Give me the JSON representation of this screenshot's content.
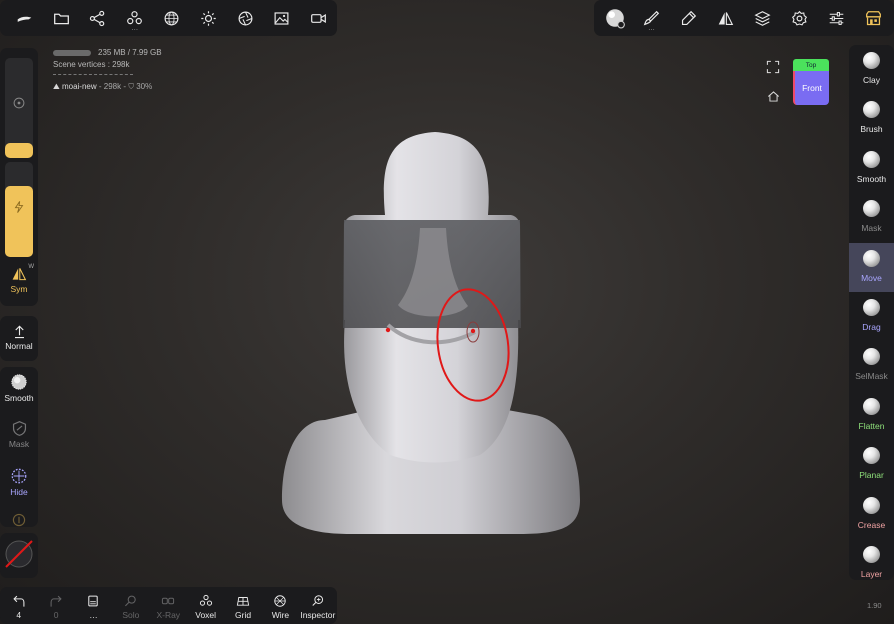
{
  "top_toolbar_left": {
    "icons": [
      "pointer-arrow-icon",
      "folder-icon",
      "scene-graph-icon",
      "primitives-icon",
      "wireframe-sphere-icon",
      "lighting-sun-icon",
      "aperture-icon",
      "image-icon",
      "video-camera-icon"
    ]
  },
  "top_toolbar_right": {
    "icons": [
      "material-sphere-icon",
      "paint-brush-icon",
      "stroke-pen-icon",
      "symmetry-icon",
      "layers-icon",
      "settings-gear-icon",
      "sliders-icon",
      "store-icon"
    ]
  },
  "info": {
    "memory": "235 MB / 7.99 GB",
    "scene_vertices": "Scene vertices : 298k",
    "mesh_name": "moai-new",
    "mesh_details": " - 298k - ",
    "mesh_percent": "30%"
  },
  "left_panel": {
    "radius_value": 0.15,
    "intensity_value": 0.75,
    "sym_label": "Sym",
    "sym_badge": "W",
    "normal_label": "Normal",
    "smooth_label": "Smooth",
    "mask_label": "Mask",
    "hide_label": "Hide"
  },
  "right_tools": {
    "items": [
      {
        "label": "Clay",
        "color": "#e8e8e8"
      },
      {
        "label": "Brush",
        "color": "#e8e8e8"
      },
      {
        "label": "Smooth",
        "color": "#e8e8e8"
      },
      {
        "label": "Mask",
        "color": "#8a8a8a"
      },
      {
        "label": "Move",
        "color": "#a9a6ff",
        "active": true
      },
      {
        "label": "Drag",
        "color": "#a9a6ff"
      },
      {
        "label": "SelMask",
        "color": "#8a8a8a"
      },
      {
        "label": "Flatten",
        "color": "#8ee07a"
      },
      {
        "label": "Planar",
        "color": "#8ee07a"
      },
      {
        "label": "Crease",
        "color": "#f0a3a3"
      },
      {
        "label": "Layer",
        "color": "#f0a3a3"
      }
    ]
  },
  "view_cube": {
    "top_label": "Top",
    "front_label": "Front"
  },
  "bottom_bar": {
    "undo_count": "4",
    "redo_count": "0",
    "solo_label": "Solo",
    "xray_label": "X-Ray",
    "voxel_label": "Voxel",
    "grid_label": "Grid",
    "wire_label": "Wire",
    "inspector_label": "Inspector"
  },
  "version": "1.90",
  "colors": {
    "accent_yellow": "#f0c35a",
    "move_accent": "#a9a6ff",
    "brush_ring": "#e01818"
  }
}
